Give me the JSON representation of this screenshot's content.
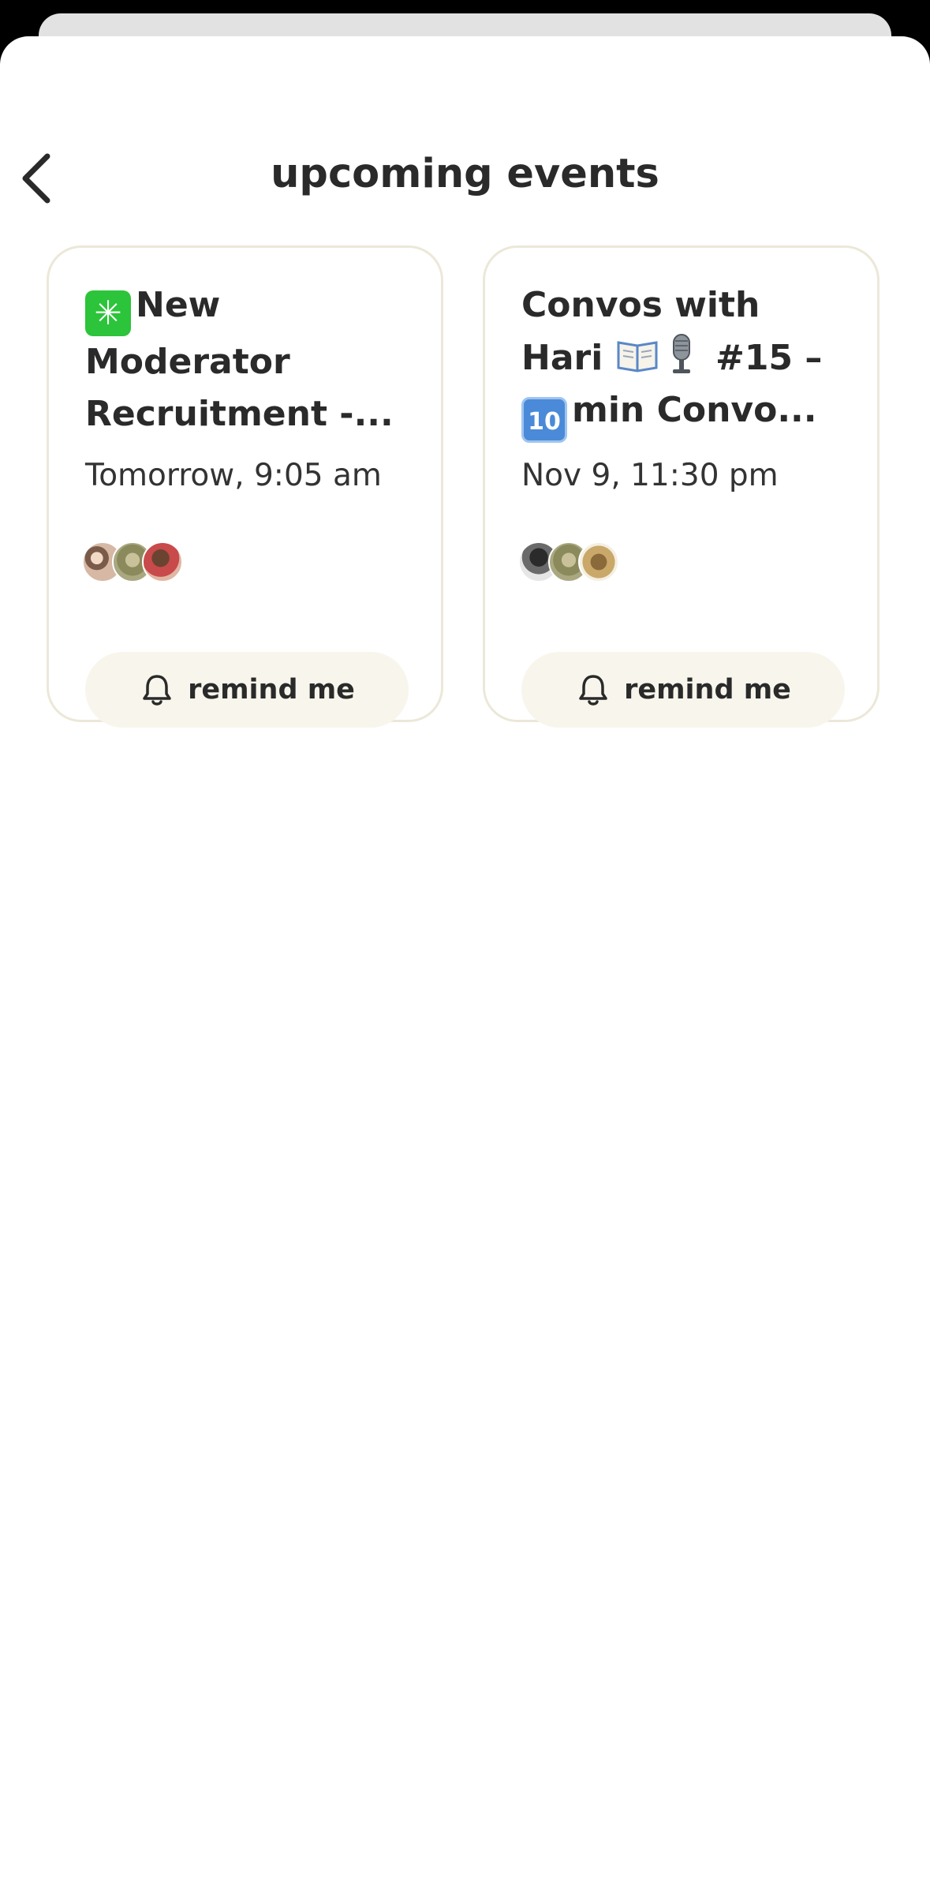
{
  "header": {
    "title": "upcoming events"
  },
  "events": [
    {
      "title_line1": "New",
      "title_line2": "Moderator",
      "title_line3": "Recruitment -...",
      "title_emoji": "eight-spoked-asterisk",
      "time": "Tomorrow, 9:05 am",
      "remind_label": "remind me"
    },
    {
      "title_line1": "Convos with",
      "title_line2_a": "Hari",
      "title_line2_b": "#15 –",
      "title_line3": "min Convo...",
      "title_emojis": [
        "open-book",
        "microphone",
        "keycap-ten"
      ],
      "keycap_text": "10",
      "time": "Nov 9, 11:30 pm",
      "remind_label": "remind me"
    }
  ],
  "colors": {
    "card_border": "#ece8d8",
    "button_bg": "#f8f6ec",
    "text": "#2a2a2a",
    "asterisk_green": "#2cc43a"
  }
}
